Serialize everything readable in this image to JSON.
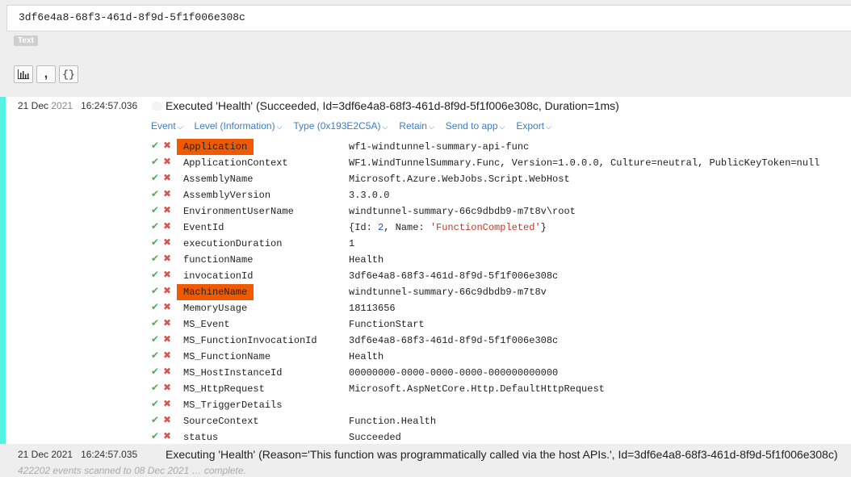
{
  "search": {
    "value": "3df6e4a8-68f3-461d-8f9d-5f1f006e308c",
    "mode_badge": "Text"
  },
  "toolbar": {
    "buttons": [
      {
        "icon": "bar-chart-icon",
        "glyph": "📊"
      },
      {
        "icon": "comma-icon",
        "glyph": "❜"
      },
      {
        "icon": "braces-icon",
        "glyph": "{}"
      }
    ]
  },
  "event1": {
    "date": "21 Dec ",
    "year": "2021",
    "time": "16:24:57.036",
    "message": "Executed 'Health' (Succeeded, Id=3df6e4a8-68f3-461d-8f9d-5f1f006e308c, Duration=1ms)",
    "actions": [
      "Event",
      "Level (Information)",
      "Type (0x193E2C5A)",
      "Retain",
      "Send to app",
      "Export"
    ],
    "properties": [
      {
        "name": "Application",
        "value": "wf1-windtunnel-summary-api-func",
        "highlight": true
      },
      {
        "name": "ApplicationContext",
        "value": "WF1.WindTunnelSummary.Func, Version=1.0.0.0, Culture=neutral, PublicKeyToken=null"
      },
      {
        "name": "AssemblyName",
        "value": "Microsoft.Azure.WebJobs.Script.WebHost"
      },
      {
        "name": "AssemblyVersion",
        "value": "3.3.0.0"
      },
      {
        "name": "EnvironmentUserName",
        "value": "windtunnel-summary-66c9dbdb9-m7t8v\\root"
      },
      {
        "name": "EventId",
        "value": ""
      },
      {
        "name": "executionDuration",
        "value": "1"
      },
      {
        "name": "functionName",
        "value": "Health"
      },
      {
        "name": "invocationId",
        "value": "3df6e4a8-68f3-461d-8f9d-5f1f006e308c"
      },
      {
        "name": "MachineName",
        "value": "windtunnel-summary-66c9dbdb9-m7t8v",
        "highlight": true
      },
      {
        "name": "MemoryUsage",
        "value": "18113656"
      },
      {
        "name": "MS_Event",
        "value": "FunctionStart"
      },
      {
        "name": "MS_FunctionInvocationId",
        "value": "3df6e4a8-68f3-461d-8f9d-5f1f006e308c"
      },
      {
        "name": "MS_FunctionName",
        "value": "Health"
      },
      {
        "name": "MS_HostInstanceId",
        "value": "00000000-0000-0000-0000-000000000000"
      },
      {
        "name": "MS_HttpRequest",
        "value": "Microsoft.AspNetCore.Http.DefaultHttpRequest"
      },
      {
        "name": "MS_TriggerDetails",
        "value": ""
      },
      {
        "name": "SourceContext",
        "value": "Function.Health"
      },
      {
        "name": "status",
        "value": "Succeeded"
      }
    ],
    "event_id_parts": {
      "open": "{Id: ",
      "id": "2",
      "mid": ", Name: ",
      "name": "'FunctionCompleted'",
      "close": "}"
    }
  },
  "event2": {
    "date": "21 Dec 2021",
    "time": "16:24:57.035",
    "message": "Executing 'Health' (Reason='This function was programmatically called via the host APIs.', Id=3df6e4a8-68f3-461d-8f9d-5f1f006e308c)"
  },
  "status_line": "422202 events scanned to 08 Dec 2021 … complete.",
  "colors": {
    "accent": "#55f3e4",
    "highlight": "#ef5a00",
    "link": "#3a7ec6",
    "ok": "#5aa35a",
    "remove": "#d9534f"
  }
}
